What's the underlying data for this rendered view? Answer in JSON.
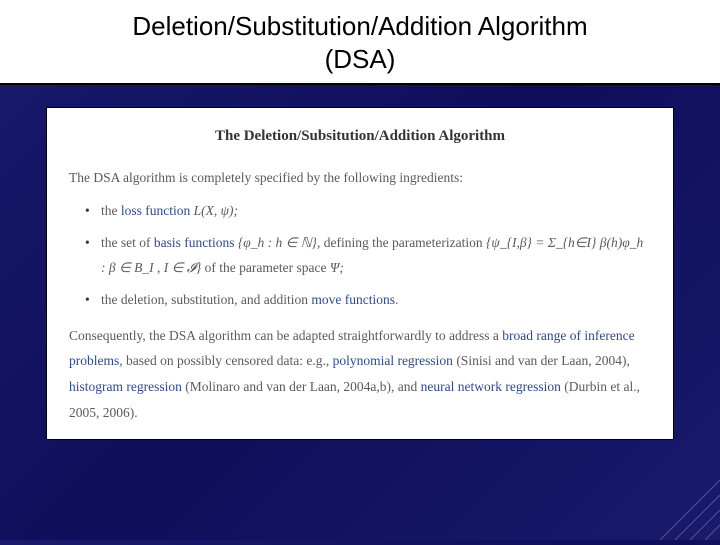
{
  "slide": {
    "title_line1": "Deletion/Substitution/Addition Algorithm",
    "title_line2": "(DSA)"
  },
  "doc": {
    "heading": "The Deletion/Subsitution/Addition Algorithm",
    "intro": "The DSA algorithm is completely specified by the following ingredients:",
    "bullets": [
      {
        "prefix": "the ",
        "hl": "loss function",
        "math": " L(X, ψ);"
      },
      {
        "prefix": "the set of ",
        "hl": "basis functions",
        "math": " {φ_h : h ∈ ℕ}, ",
        "tail1": "defining the parameterization ",
        "math2": "{ψ_{I,β} = Σ_{h∈I} β(h)φ_h : β ∈ B_I ,  I ∈ 𝓘}",
        "tail2": " of the parameter space ",
        "math3": "Ψ;"
      },
      {
        "prefix": "the deletion, substitution, and addition ",
        "hl": "move functions",
        "tail": "."
      }
    ],
    "conclude_a": "Consequently, the DSA algorithm can be adapted straightforwardly to address a ",
    "conclude_hl1": "broad range of inference problems",
    "conclude_b": ", based on possibly censored data: e.g., ",
    "conclude_hl2": "polynomial regression",
    "conclude_c": " (Sinisi and van der Laan, 2004), ",
    "conclude_hl3": "histogram regression",
    "conclude_d": " (Molinaro and van der Laan, 2004a,b), and ",
    "conclude_hl4": "neural network regression",
    "conclude_e": " (Durbin et al., 2005, 2006)."
  }
}
